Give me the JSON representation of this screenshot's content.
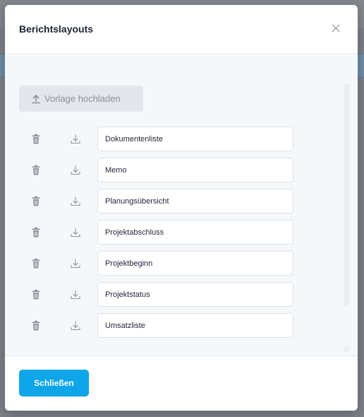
{
  "modal": {
    "title": "Berichtslayouts",
    "upload_label": "Vorlage hochladen",
    "close_label": "Schließen"
  },
  "layouts": [
    {
      "name": "Dokumentenliste"
    },
    {
      "name": "Memo"
    },
    {
      "name": "Planungsübersicht"
    },
    {
      "name": "Projektabschluss"
    },
    {
      "name": "Projektbeginn"
    },
    {
      "name": "Projektstatus"
    },
    {
      "name": "Umsatzliste"
    }
  ],
  "icons": {
    "close": "close-icon",
    "upload": "upload-icon",
    "delete": "trash-icon",
    "download": "download-icon"
  },
  "colors": {
    "primary": "#0ea5e9",
    "secondary_button": "#e3e6ec",
    "body_background": "#f5f8fb"
  }
}
